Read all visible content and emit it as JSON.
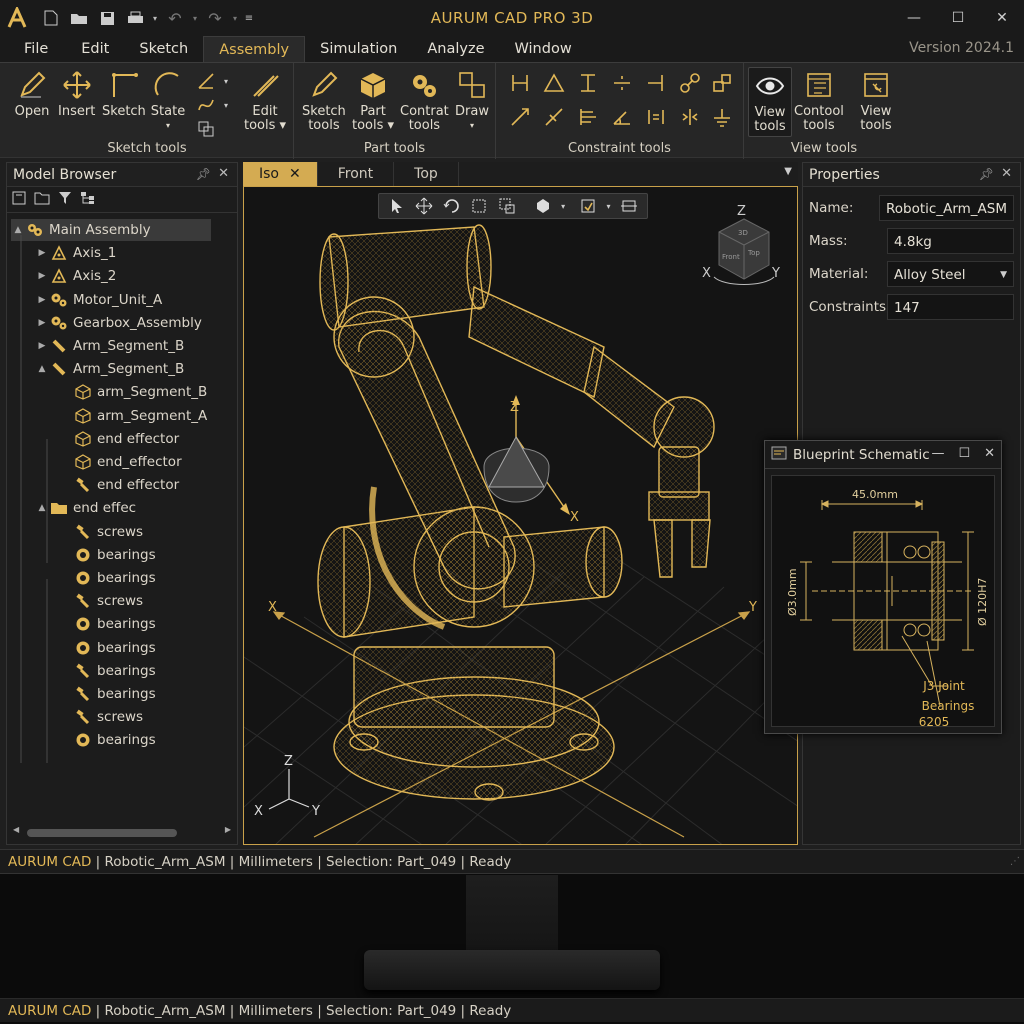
{
  "titlebar": {
    "title": "AURUM CAD PRO 3D",
    "logo_icon": "aurum-logo-icon"
  },
  "menubar": {
    "items": [
      "File",
      "Edit",
      "Sketch",
      "Assembly",
      "Simulation",
      "Analyze",
      "Window"
    ],
    "active": "Assembly",
    "version": "Version 2024.1"
  },
  "ribbon": {
    "groups": [
      {
        "label": "Sketch tools",
        "buttons": [
          {
            "label": "Open",
            "icon": "pencil-icon"
          },
          {
            "label": "Insert",
            "icon": "move-arrows-icon"
          },
          {
            "label": "Sketch",
            "icon": "corner-line-icon"
          },
          {
            "label": "State",
            "icon": "arc-icon",
            "sub": "▾"
          }
        ]
      },
      {
        "label": "",
        "buttons": [
          {
            "label": "Edit",
            "label2": "tools ▾",
            "icon": "ruler-pen-icon"
          }
        ]
      },
      {
        "label": "Part tools",
        "buttons": [
          {
            "label": "Sketch",
            "label2": "tools",
            "icon": "sketch-pencil-icon"
          },
          {
            "label": "Part",
            "label2": "tools ▾",
            "icon": "cube-icon"
          },
          {
            "label": "Contrat",
            "label2": "tools",
            "icon": "gears-icon"
          },
          {
            "label": "Draw",
            "label2": "▾",
            "icon": "draw-boxes-icon"
          }
        ]
      },
      {
        "label": "Constraint tools",
        "buttons": []
      },
      {
        "label": "View tools",
        "buttons": [
          {
            "label": "View",
            "label2": "tools",
            "icon": "eye-icon"
          },
          {
            "label": "Contool",
            "label2": "tools",
            "icon": "window-grid-icon"
          },
          {
            "label": "View",
            "label2": "tools",
            "icon": "window-tools-icon"
          }
        ]
      }
    ]
  },
  "model_browser": {
    "title": "Model Browser",
    "items": [
      {
        "label": "Main Assembly",
        "icon": "assembly-icon",
        "level": 0,
        "expand": "▲",
        "selected": true
      },
      {
        "label": "Axis_1",
        "icon": "axis-icon",
        "level": 1,
        "expand": "▶"
      },
      {
        "label": "Axis_2",
        "icon": "axis-icon",
        "level": 1,
        "expand": "▶"
      },
      {
        "label": "Motor_Unit_A",
        "icon": "gears-icon",
        "level": 1,
        "expand": "▶"
      },
      {
        "label": "Gearbox_Assembly",
        "icon": "gears-icon",
        "level": 1,
        "expand": "▶"
      },
      {
        "label": "Arm_Segment_B",
        "icon": "arm-icon",
        "level": 1,
        "expand": "▶"
      },
      {
        "label": "Arm_Segment_B",
        "icon": "arm-icon",
        "level": 1,
        "expand": "▲"
      },
      {
        "label": "arm_Segment_B",
        "icon": "cube-outline-icon",
        "level": 2,
        "expand": ""
      },
      {
        "label": "arm_Segment_A",
        "icon": "cube-outline-icon",
        "level": 2,
        "expand": ""
      },
      {
        "label": "end effector",
        "icon": "cube-outline-icon",
        "level": 2,
        "expand": ""
      },
      {
        "label": "end_effector",
        "icon": "cube-outline-icon",
        "level": 2,
        "expand": ""
      },
      {
        "label": "end effector",
        "icon": "screw-icon",
        "level": 2,
        "expand": ""
      },
      {
        "label": "end effec",
        "icon": "folder-icon",
        "level": 1,
        "expand": "▲"
      },
      {
        "label": "screws",
        "icon": "screw-icon",
        "level": 2,
        "expand": ""
      },
      {
        "label": "bearings",
        "icon": "bearing-icon",
        "level": 2,
        "expand": ""
      },
      {
        "label": "bearings",
        "icon": "bearing-icon",
        "level": 2,
        "expand": ""
      },
      {
        "label": "screws",
        "icon": "screw-icon",
        "level": 2,
        "expand": ""
      },
      {
        "label": "bearings",
        "icon": "bearing-icon",
        "level": 2,
        "expand": ""
      },
      {
        "label": "bearings",
        "icon": "bearing-icon",
        "level": 2,
        "expand": ""
      },
      {
        "label": "bearings",
        "icon": "screw-icon",
        "level": 2,
        "expand": ""
      },
      {
        "label": "bearings",
        "icon": "screw-icon",
        "level": 2,
        "expand": ""
      },
      {
        "label": "screws",
        "icon": "screw-icon",
        "level": 2,
        "expand": ""
      },
      {
        "label": "bearings",
        "icon": "bearing-icon",
        "level": 2,
        "expand": ""
      }
    ]
  },
  "viewport": {
    "tabs": [
      "Iso",
      "Front",
      "Top"
    ],
    "active_tab": "Iso",
    "view_cube": {
      "z": "Z",
      "x": "X",
      "y": "Y",
      "face1": "Front",
      "face2": "Top",
      "face3": "3D"
    },
    "gizmo": {
      "z": "Z",
      "x": "X"
    },
    "floor_axes": {
      "x": "X",
      "y": "Y"
    },
    "corner_axes": {
      "z": "Z",
      "x": "X",
      "y": "Y"
    }
  },
  "properties": {
    "title": "Properties",
    "rows": [
      {
        "label": "Name:",
        "value": "Robotic_Arm_ASM"
      },
      {
        "label": "Mass:",
        "value": "4.8kg"
      },
      {
        "label": "Material:",
        "value": "Alloy Steel"
      },
      {
        "label": "Constraints:",
        "value": "147"
      }
    ]
  },
  "blueprint": {
    "title": "Blueprint Schematic",
    "dim_top": "45.0mm",
    "dim_left": "Ø3.0mm",
    "dim_right": "Ø 120H7",
    "callout1": "J3 Joint",
    "callout2": "Bearings",
    "callout3": "6205"
  },
  "status": {
    "brand": "AURUM CAD",
    "text": " | Robotic_Arm_ASM | Millimeters | Selection: Part_049 | Ready"
  },
  "colors": {
    "accent": "#e2b857",
    "panel": "#1c1c1c",
    "viewport": "#141414"
  }
}
